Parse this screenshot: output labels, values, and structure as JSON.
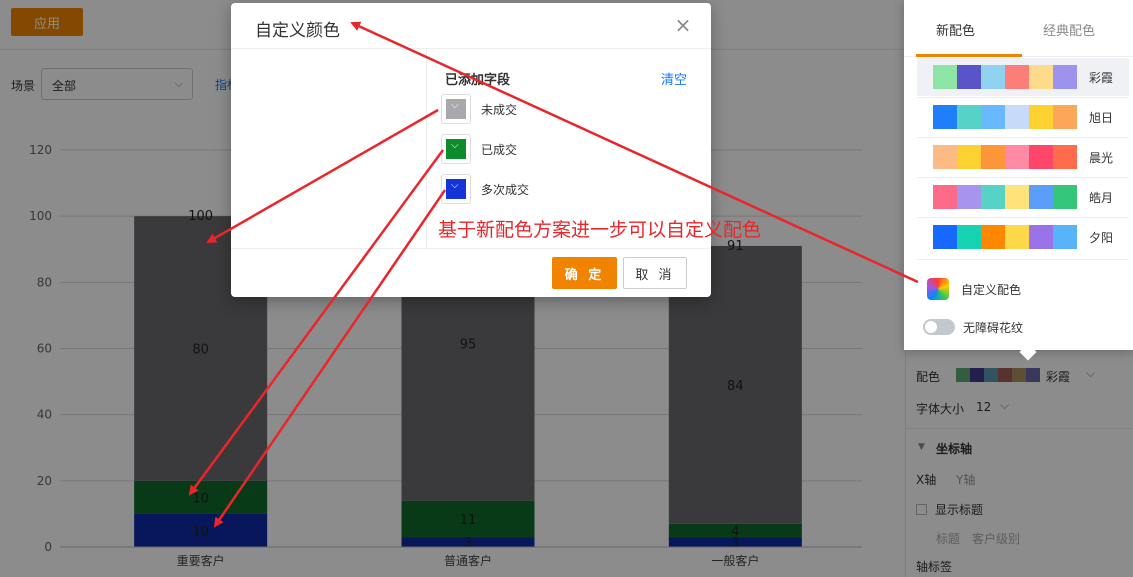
{
  "toolbar": {
    "apply_label": "应用"
  },
  "filter": {
    "scene_label": "场景",
    "scene_value": "全部",
    "metric_link": "指标"
  },
  "chart_data": {
    "type": "bar",
    "stacked": true,
    "categories": [
      "重要客户",
      "普通客户",
      "一般客户"
    ],
    "series": [
      {
        "name": "多次成交",
        "values": [
          10,
          3,
          3
        ],
        "color": "#102aa6"
      },
      {
        "name": "已成交",
        "values": [
          10,
          11,
          4
        ],
        "color": "#0f6a2a"
      },
      {
        "name": "未成交",
        "values": [
          80,
          95,
          84
        ],
        "color": "#6b6a70"
      }
    ],
    "totals": [
      100,
      null,
      91
    ],
    "ylim": [
      0,
      120
    ],
    "yticks": [
      0,
      20,
      40,
      60,
      80,
      100,
      120
    ],
    "grid": true
  },
  "modal": {
    "title": "自定义颜色",
    "added_title": "已添加字段",
    "clear_label": "清空",
    "fields": [
      {
        "name": "未成交",
        "color": "#a8a8ad"
      },
      {
        "name": "已成交",
        "color": "#0f8a2c"
      },
      {
        "name": "多次成交",
        "color": "#1434d8"
      }
    ],
    "ok_label": "确 定",
    "cancel_label": "取 消"
  },
  "scheme_popup": {
    "tabs": [
      "新配色",
      "经典配色"
    ],
    "schemes": [
      {
        "name": "彩霞",
        "colors": [
          "#8de4a4",
          "#5a54c9",
          "#8fd3f0",
          "#fc7e79",
          "#fedb8a",
          "#9c94ec"
        ]
      },
      {
        "name": "旭日",
        "colors": [
          "#1e7ff8",
          "#56d3c6",
          "#67b8ff",
          "#c7daf9",
          "#fdd130",
          "#fca65a"
        ]
      },
      {
        "name": "晨光",
        "colors": [
          "#fdba84",
          "#fdd130",
          "#fe953a",
          "#fe8aa3",
          "#fd4669",
          "#fe6c4b"
        ]
      },
      {
        "name": "皓月",
        "colors": [
          "#fe6b88",
          "#a794ee",
          "#56d3c6",
          "#fee27a",
          "#5a9ef9",
          "#34c779"
        ]
      },
      {
        "name": "夕阳",
        "colors": [
          "#1768ff",
          "#17d1b3",
          "#fd8700",
          "#fed84a",
          "#9a72ea",
          "#58b3f9"
        ]
      }
    ],
    "custom_label": "自定义配色",
    "toggle_label": "无障碍花纹"
  },
  "config": {
    "color_label": "配色",
    "color_value": "彩霞",
    "color_strip": [
      "#5bab73",
      "#3d3a8a",
      "#5b9ab1",
      "#a45a59",
      "#a8915e",
      "#6b67a5"
    ],
    "font_size_label": "字体大小",
    "font_size_value": "12",
    "axis_section": "坐标轴",
    "x_axis": "X轴",
    "y_axis": "Y轴",
    "show_title": "显示标题",
    "title_label": "标题",
    "title_value": "客户级别",
    "axis_label": "轴标签"
  },
  "annotation": {
    "text": "基于新配色方案进一步可以自定义配色",
    "color": "#e8262b"
  }
}
